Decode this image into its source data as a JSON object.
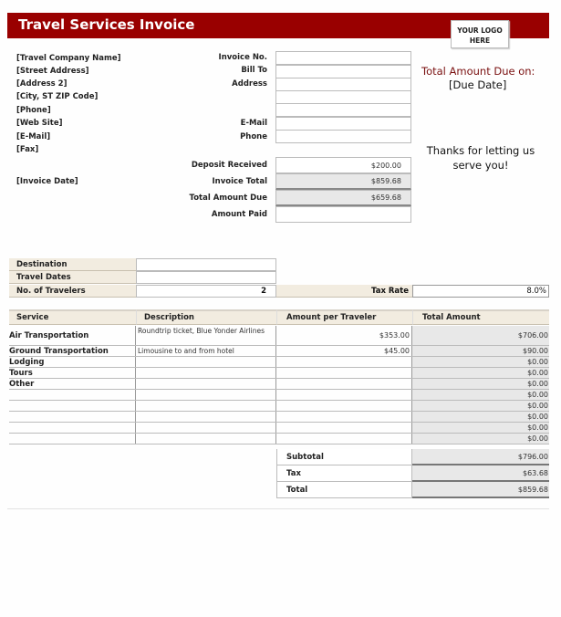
{
  "header": {
    "title": "Travel Services Invoice",
    "logo_placeholder": "YOUR LOGO HERE"
  },
  "company": {
    "lines": [
      "[Travel Company Name]",
      "[Street Address]",
      "[Address 2]",
      "[City, ST  ZIP Code]",
      "[Phone]",
      "[Web Site]",
      "[E-Mail]",
      "[Fax]"
    ],
    "invoice_date": "[Invoice Date]"
  },
  "bill_fields": [
    {
      "label": "Invoice No.",
      "value": ""
    },
    {
      "label": "Bill To",
      "value": ""
    },
    {
      "label": "Address",
      "value": ""
    },
    {
      "label": "",
      "value": ""
    },
    {
      "label": "E-Mail",
      "value": ""
    },
    {
      "label": "Phone",
      "value": ""
    }
  ],
  "payment_fields": [
    {
      "label": "Deposit Received",
      "value": "$200.00"
    },
    {
      "label": "Invoice Total",
      "value": "$859.68"
    },
    {
      "label": "Total Amount Due",
      "value": "$659.68"
    },
    {
      "label": "Amount Paid",
      "value": ""
    }
  ],
  "due": {
    "title": "Total Amount Due on:",
    "date": "[Due Date]"
  },
  "thanks": "Thanks for letting us serve you!",
  "trip": [
    {
      "label": "Destination",
      "value": ""
    },
    {
      "label": "Travel Dates",
      "value": ""
    },
    {
      "label": "No. of Travelers",
      "value": "2"
    }
  ],
  "tax": {
    "label": "Tax Rate",
    "value": "8.0%"
  },
  "services": {
    "headers": [
      "Service",
      "Description",
      "Amount per Traveler",
      "Total Amount"
    ],
    "rows": [
      {
        "service": "Air Transportation",
        "description": "Roundtrip ticket, Blue Yonder Airlines",
        "amount": "$353.00",
        "total": "$706.00"
      },
      {
        "service": "Ground Transportation",
        "description": "Limousine to and from hotel",
        "amount": "$45.00",
        "total": "$90.00"
      },
      {
        "service": "Lodging",
        "description": "",
        "amount": "",
        "total": "$0.00"
      },
      {
        "service": "Tours",
        "description": "",
        "amount": "",
        "total": "$0.00"
      },
      {
        "service": "Other",
        "description": "",
        "amount": "",
        "total": "$0.00"
      },
      {
        "service": "",
        "description": "",
        "amount": "",
        "total": "$0.00"
      },
      {
        "service": "",
        "description": "",
        "amount": "",
        "total": "$0.00"
      },
      {
        "service": "",
        "description": "",
        "amount": "",
        "total": "$0.00"
      },
      {
        "service": "",
        "description": "",
        "amount": "",
        "total": "$0.00"
      },
      {
        "service": "",
        "description": "",
        "amount": "",
        "total": "$0.00"
      }
    ]
  },
  "summary": [
    {
      "label": "Subtotal",
      "value": "$796.00"
    },
    {
      "label": "Tax",
      "value": "$63.68"
    },
    {
      "label": "Total",
      "value": "$859.68"
    }
  ]
}
